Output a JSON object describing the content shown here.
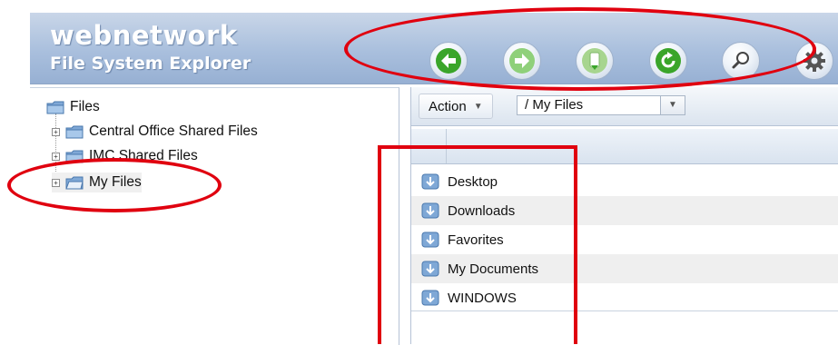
{
  "app": {
    "brand_line1": "webnetwork",
    "brand_line2": "File System Explorer"
  },
  "toolbar": {
    "buttons": [
      {
        "name": "back",
        "icon": "arrow-left-icon"
      },
      {
        "name": "forward",
        "icon": "arrow-right-icon"
      },
      {
        "name": "upload",
        "icon": "upload-icon"
      },
      {
        "name": "refresh",
        "icon": "refresh-icon"
      },
      {
        "name": "search",
        "icon": "magnifier-icon"
      },
      {
        "name": "settings",
        "icon": "gear-icon"
      }
    ]
  },
  "tree": {
    "root_label": "Files",
    "items": [
      {
        "label": "Central Office Shared Files"
      },
      {
        "label": "IMC Shared Files"
      },
      {
        "label": "My Files"
      }
    ]
  },
  "file_pane": {
    "action_label": "Action",
    "path_value": "/ My Files",
    "rows": [
      {
        "label": "Desktop"
      },
      {
        "label": "Downloads"
      },
      {
        "label": "Favorites"
      },
      {
        "label": "My Documents"
      },
      {
        "label": "WINDOWS"
      }
    ]
  },
  "colors": {
    "annotation": "#e0000f",
    "header": "#a9bfdd",
    "back_green": "#3aa52a",
    "forward_green": "#8fd07a"
  }
}
